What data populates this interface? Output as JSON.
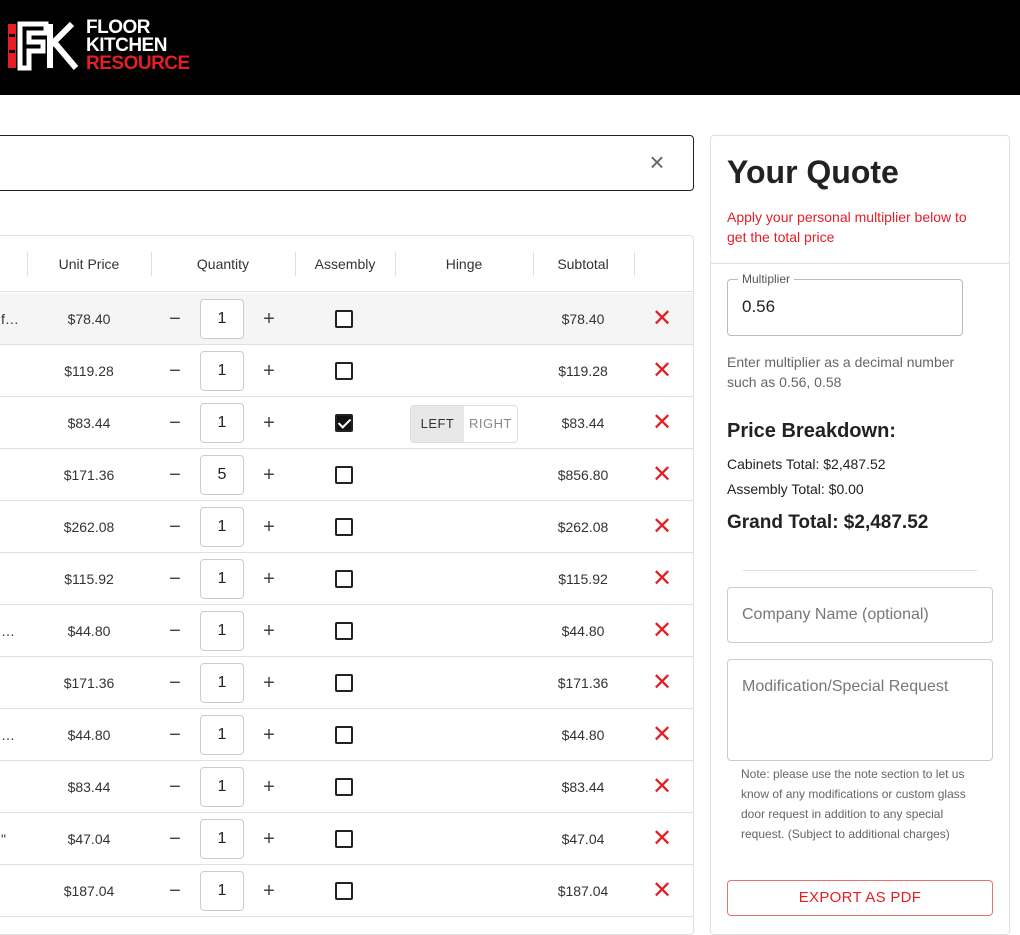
{
  "brand": {
    "line1": "FLOOR",
    "line2": "KITCHEN",
    "line3": "RESOURCE",
    "accent": "#e31e24"
  },
  "search": {
    "close_icon": "close-icon"
  },
  "table": {
    "headers": {
      "unit_price": "Unit Price",
      "quantity": "Quantity",
      "assembly": "Assembly",
      "hinge": "Hinge",
      "subtotal": "Subtotal"
    },
    "hinge_left": "LEFT",
    "hinge_right": "RIGHT",
    "rows": [
      {
        "name": "f…",
        "price": "$78.40",
        "qty": "1",
        "minus": "−",
        "plus": "+",
        "assembly": false,
        "hinge": false,
        "subtotal": "$78.40",
        "del": "✕"
      },
      {
        "name": "",
        "price": "$119.28",
        "qty": "1",
        "minus": "−",
        "plus": "+",
        "assembly": false,
        "hinge": false,
        "subtotal": "$119.28",
        "del": "✕"
      },
      {
        "name": "",
        "price": "$83.44",
        "qty": "1",
        "minus": "−",
        "plus": "+",
        "assembly": true,
        "hinge": true,
        "subtotal": "$83.44",
        "del": "✕"
      },
      {
        "name": "",
        "price": "$171.36",
        "qty": "5",
        "minus": "−",
        "plus": "+",
        "assembly": false,
        "hinge": false,
        "subtotal": "$856.80",
        "del": "✕"
      },
      {
        "name": "",
        "price": "$262.08",
        "qty": "1",
        "minus": "−",
        "plus": "+",
        "assembly": false,
        "hinge": false,
        "subtotal": "$262.08",
        "del": "✕"
      },
      {
        "name": "",
        "price": "$115.92",
        "qty": "1",
        "minus": "−",
        "plus": "+",
        "assembly": false,
        "hinge": false,
        "subtotal": "$115.92",
        "del": "✕"
      },
      {
        "name": "…",
        "price": "$44.80",
        "qty": "1",
        "minus": "−",
        "plus": "+",
        "assembly": false,
        "hinge": false,
        "subtotal": "$44.80",
        "del": "✕"
      },
      {
        "name": "",
        "price": "$171.36",
        "qty": "1",
        "minus": "−",
        "plus": "+",
        "assembly": false,
        "hinge": false,
        "subtotal": "$171.36",
        "del": "✕"
      },
      {
        "name": "…",
        "price": "$44.80",
        "qty": "1",
        "minus": "−",
        "plus": "+",
        "assembly": false,
        "hinge": false,
        "subtotal": "$44.80",
        "del": "✕"
      },
      {
        "name": "",
        "price": "$83.44",
        "qty": "1",
        "minus": "−",
        "plus": "+",
        "assembly": false,
        "hinge": false,
        "subtotal": "$83.44",
        "del": "✕"
      },
      {
        "name": "\"",
        "price": "$47.04",
        "qty": "1",
        "minus": "−",
        "plus": "+",
        "assembly": false,
        "hinge": false,
        "subtotal": "$47.04",
        "del": "✕"
      },
      {
        "name": "",
        "price": "$187.04",
        "qty": "1",
        "minus": "−",
        "plus": "+",
        "assembly": false,
        "hinge": false,
        "subtotal": "$187.04",
        "del": "✕"
      }
    ]
  },
  "quote": {
    "title": "Your Quote",
    "subtitle": "Apply your personal multiplier below to get the total price",
    "multiplier_label": "Multiplier",
    "multiplier_value": "0.56",
    "multiplier_help": "Enter multiplier as a decimal number such as 0.56, 0.58",
    "breakdown_title": "Price Breakdown:",
    "cabinets_total": "Cabinets Total: $2,487.52",
    "assembly_total": "Assembly Total: $0.00",
    "grand_total": "Grand Total: $2,487.52",
    "company_placeholder": "Company Name (optional)",
    "modification_placeholder": "Modification/Special Request",
    "note": "Note: please use the note section to let us know of any modifications or custom glass door request in addition to any special request. (Subject to additional charges)",
    "export_label": "EXPORT AS PDF"
  }
}
